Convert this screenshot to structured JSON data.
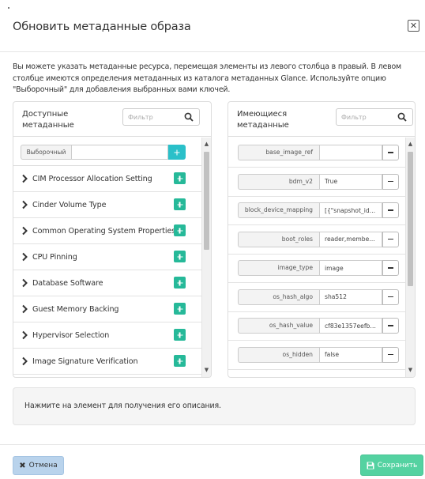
{
  "modal": {
    "title": "Обновить метаданные образа",
    "close_icon": "close-icon",
    "description": "Вы можете указать метаданные ресурса, перемещая элементы из левого столбца в правый. В левом столбце имеются определения метаданных из каталога метаданных Glance. Используйте опцию \"Выборочный\" для добавления выбранных вами ключей."
  },
  "available": {
    "title": "Доступные метаданные",
    "filter_placeholder": "Фильтр",
    "custom_label": "Выборочный",
    "custom_value": "",
    "items": [
      {
        "label": "CIM Processor Allocation Setting"
      },
      {
        "label": "Cinder Volume Type"
      },
      {
        "label": "Common Operating System Properties"
      },
      {
        "label": "CPU Pinning"
      },
      {
        "label": "Database Software"
      },
      {
        "label": "Guest Memory Backing"
      },
      {
        "label": "Hypervisor Selection"
      },
      {
        "label": "Image Signature Verification"
      }
    ]
  },
  "existing": {
    "title": "Имеющиеся метаданные",
    "filter_placeholder": "Фильтр",
    "items": [
      {
        "key": "base_image_ref",
        "value": ""
      },
      {
        "key": "bdm_v2",
        "value": "True"
      },
      {
        "key": "block_device_mapping",
        "value": "[{\"snapshot_id\": \"..."
      },
      {
        "key": "boot_roles",
        "value": "reader,member,a..."
      },
      {
        "key": "image_type",
        "value": "image"
      },
      {
        "key": "os_hash_algo",
        "value": "sha512"
      },
      {
        "key": "os_hash_value",
        "value": "cf83e1357eefb8b..."
      },
      {
        "key": "os_hidden",
        "value": "false"
      }
    ]
  },
  "help_text": "Нажмите на элемент для получения его описания.",
  "footer": {
    "cancel_label": "Отмена",
    "save_label": "Сохранить"
  },
  "colors": {
    "add_button": "#26b999",
    "custom_add_button": "#2ac0c9",
    "cancel_button": "#b9d3ec",
    "save_button": "#54d2a1"
  }
}
